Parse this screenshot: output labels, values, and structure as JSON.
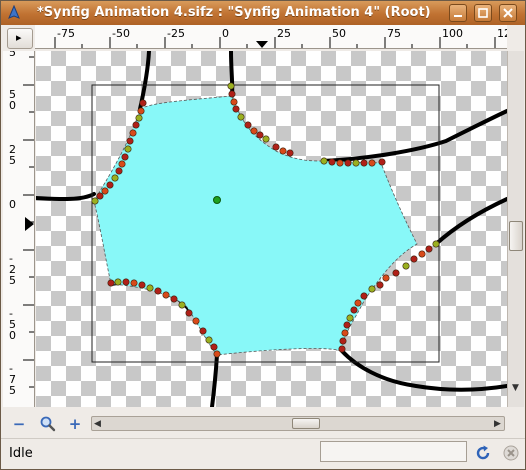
{
  "window": {
    "title": "*Synfig Animation 4.sifz : \"Synfig Animation 4\" (Root)",
    "minimize_icon": "minimize-icon",
    "maximize_icon": "maximize-icon",
    "close_icon": "close-icon"
  },
  "ruler": {
    "corner_glyph": "▸",
    "horizontal_labels": [
      "-75",
      "-50",
      "-25",
      "0",
      "25",
      "50",
      "75",
      "100",
      "12"
    ],
    "vertical_labels": [
      {
        "top": "5",
        "bottom": ""
      },
      {
        "top": "5",
        "bottom": "0"
      },
      {
        "top": "2",
        "bottom": "5"
      },
      {
        "top": "0",
        "bottom": ""
      },
      {
        "top": "-",
        "bottom": "2"
      },
      {
        "top": "5",
        "bottom": ""
      },
      {
        "top": "-",
        "bottom": "5"
      },
      {
        "top": "0",
        "bottom": ""
      },
      {
        "top": "-",
        "bottom": "7"
      },
      {
        "top": "5",
        "bottom": ""
      }
    ]
  },
  "canvas": {
    "shape_color": "#88f8f8",
    "vertex_colors": [
      "#b02018",
      "#d84a1a",
      "#9ab020"
    ],
    "outline_color": "#000000"
  },
  "toolbar": {
    "zoom_out_label": "−",
    "zoom_fit_icon": "magnifier-icon",
    "zoom_in_label": "+"
  },
  "status": {
    "text": "Idle",
    "refresh_icon": "refresh-icon",
    "stop_icon": "stop-icon"
  },
  "colors": {
    "titlebar": "#c07232",
    "window_bg": "#efebe7",
    "accent_blue": "#3a69b8"
  }
}
